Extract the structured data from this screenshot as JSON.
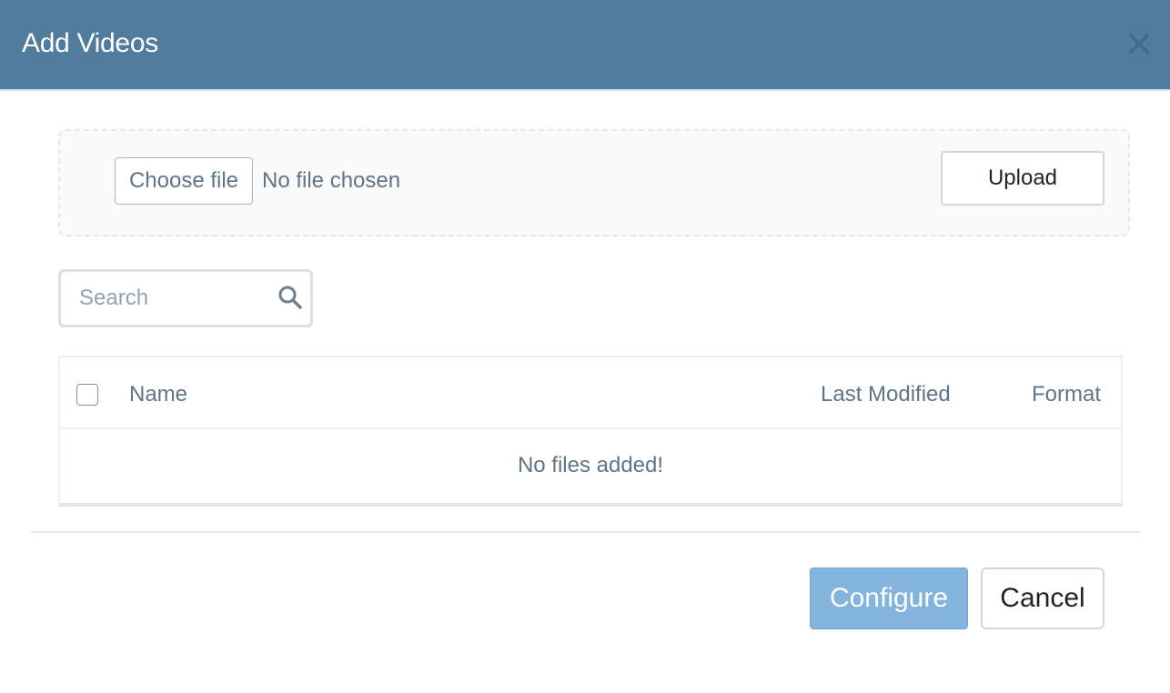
{
  "dialog": {
    "title": "Add Videos",
    "close_icon": "close-icon"
  },
  "upload": {
    "choose_file_label": "Choose file",
    "file_status": "No file chosen",
    "upload_label": "Upload"
  },
  "search": {
    "placeholder": "Search",
    "value": "",
    "icon": "search-icon"
  },
  "table": {
    "columns": [
      "Name",
      "Last Modified",
      "Format"
    ],
    "select_all_checked": false,
    "rows": [],
    "empty_message": "No files added!"
  },
  "footer": {
    "configure_label": "Configure",
    "cancel_label": "Cancel"
  },
  "colors": {
    "header_bg": "#527c9e",
    "primary_button": "#84b4dc",
    "text_muted": "#5f7488"
  }
}
